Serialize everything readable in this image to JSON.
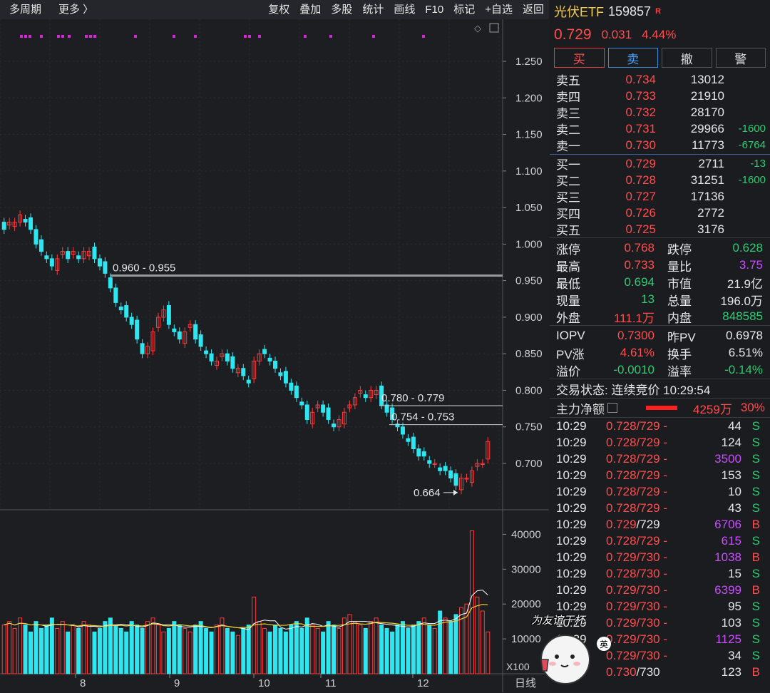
{
  "toolbar": {
    "period": "多周期",
    "more": "更多 〉",
    "buttons": [
      "复权",
      "叠加",
      "多股",
      "统计",
      "画线",
      "F10",
      "标记",
      "+自选",
      "返回"
    ]
  },
  "chart": {
    "price_axis": [
      "1.250",
      "1.200",
      "1.150",
      "1.100",
      "1.050",
      "1.000",
      "0.950",
      "0.900",
      "0.850",
      "0.800",
      "0.750",
      "0.700"
    ],
    "volume_axis": [
      "40000",
      "30000",
      "20000",
      "10000"
    ],
    "volume_unit": "X100",
    "x_labels": [
      "8",
      "9",
      "10",
      "11",
      "12"
    ],
    "period_label": "日线",
    "levels": [
      {
        "label": "0.960 - 0.955",
        "value": 0.957
      },
      {
        "label": "0.780 - 0.779",
        "value": 0.779
      },
      {
        "label": "0.754 - 0.753",
        "value": 0.753
      }
    ],
    "low_marker": "0.664"
  },
  "chart_data": {
    "type": "candlestick",
    "y_range": [
      0.66,
      1.27
    ],
    "levels": [
      0.957,
      0.779,
      0.753
    ],
    "low": 0.664,
    "close": [
      1.02,
      1.03,
      1.03,
      1.04,
      1.03,
      1.02,
      1.0,
      0.99,
      0.98,
      0.97,
      0.98,
      0.99,
      0.98,
      0.99,
      0.98,
      0.99,
      0.99,
      0.98,
      0.97,
      0.96,
      0.94,
      0.92,
      0.91,
      0.9,
      0.89,
      0.87,
      0.85,
      0.86,
      0.88,
      0.9,
      0.91,
      0.89,
      0.88,
      0.87,
      0.88,
      0.89,
      0.87,
      0.86,
      0.85,
      0.84,
      0.84,
      0.85,
      0.84,
      0.83,
      0.83,
      0.82,
      0.81,
      0.84,
      0.85,
      0.85,
      0.84,
      0.83,
      0.82,
      0.81,
      0.8,
      0.79,
      0.78,
      0.76,
      0.77,
      0.78,
      0.77,
      0.76,
      0.75,
      0.76,
      0.77,
      0.78,
      0.79,
      0.8,
      0.79,
      0.8,
      0.8,
      0.78,
      0.77,
      0.76,
      0.75,
      0.74,
      0.73,
      0.72,
      0.71,
      0.71,
      0.7,
      0.7,
      0.69,
      0.69,
      0.68,
      0.67,
      0.68,
      0.68,
      0.69,
      0.7,
      0.7,
      0.73
    ],
    "volume": [
      14,
      15,
      13,
      16,
      14,
      12,
      15,
      13,
      14,
      16,
      13,
      15,
      12,
      14,
      13,
      15,
      14,
      12,
      13,
      15,
      16,
      14,
      13,
      12,
      15,
      14,
      13,
      15,
      16,
      14,
      12,
      13,
      15,
      14,
      13,
      12,
      14,
      15,
      13,
      12,
      14,
      16,
      13,
      12,
      11,
      13,
      14,
      22,
      15,
      13,
      12,
      14,
      13,
      12,
      14,
      15,
      13,
      16,
      14,
      13,
      12,
      15,
      14,
      13,
      16,
      17,
      15,
      14,
      13,
      15,
      16,
      14,
      13,
      12,
      14,
      15,
      13,
      14,
      15,
      16,
      14,
      13,
      18,
      16,
      15,
      17,
      19,
      20,
      41,
      22,
      18,
      12
    ]
  },
  "quote": {
    "name": "光伏ETF",
    "code": "159857",
    "badge": "R",
    "price": "0.729",
    "change": "0.031",
    "change_pct": "4.44%",
    "actions": [
      "买",
      "卖",
      "撤",
      "警"
    ],
    "asks": [
      {
        "label": "卖五",
        "price": "0.734",
        "vol": "13012",
        "chg": ""
      },
      {
        "label": "卖四",
        "price": "0.733",
        "vol": "21910",
        "chg": ""
      },
      {
        "label": "卖三",
        "price": "0.732",
        "vol": "28170",
        "chg": ""
      },
      {
        "label": "卖二",
        "price": "0.731",
        "vol": "29966",
        "chg": "-1600"
      },
      {
        "label": "卖一",
        "price": "0.730",
        "vol": "11773",
        "chg": "-6764"
      }
    ],
    "bids": [
      {
        "label": "买一",
        "price": "0.729",
        "vol": "2711",
        "chg": "-13"
      },
      {
        "label": "买二",
        "price": "0.728",
        "vol": "31251",
        "chg": "-1600"
      },
      {
        "label": "买三",
        "price": "0.727",
        "vol": "17136",
        "chg": ""
      },
      {
        "label": "买四",
        "price": "0.726",
        "vol": "2772",
        "chg": ""
      },
      {
        "label": "买五",
        "price": "0.725",
        "vol": "3176",
        "chg": ""
      }
    ],
    "stats1": [
      {
        "k": "涨停",
        "v": "0.768",
        "vc": "red",
        "k2": "跌停",
        "v2": "0.628",
        "v2c": "green"
      },
      {
        "k": "最高",
        "v": "0.733",
        "vc": "red",
        "k2": "量比",
        "v2": "3.75",
        "v2c": "purple"
      },
      {
        "k": "最低",
        "v": "0.694",
        "vc": "green",
        "k2": "市值",
        "v2": "21.9亿",
        "v2c": "white"
      },
      {
        "k": "现量",
        "v": "13",
        "vc": "green",
        "k2": "总量",
        "v2": "196.0万",
        "v2c": "white"
      },
      {
        "k": "外盘",
        "v": "111.1万",
        "vc": "red",
        "k2": "内盘",
        "v2": "848585",
        "v2c": "green"
      }
    ],
    "stats2": [
      {
        "k": "IOPV",
        "v": "0.7300",
        "vc": "red",
        "k2": "昨PV",
        "v2": "0.6978",
        "v2c": "white"
      },
      {
        "k": "PV涨",
        "v": "4.61%",
        "vc": "red",
        "k2": "换手",
        "v2": "6.51%",
        "v2c": "white"
      },
      {
        "k": "溢价",
        "v": "-0.0010",
        "vc": "green",
        "k2": "溢率",
        "v2": "-0.14%",
        "v2c": "green"
      }
    ],
    "status": "交易状态: 连续竞价 10:29:54",
    "main_flow": {
      "label": "主力净额",
      "amount": "4259万",
      "pct": "30%"
    },
    "ticks": [
      {
        "t": "10:29",
        "p1": "0.728",
        "p2": "/729 -",
        "v": "44",
        "vc": "white",
        "d": "S"
      },
      {
        "t": "10:29",
        "p1": "0.728",
        "p2": "/729 -",
        "v": "124",
        "vc": "white",
        "d": "S"
      },
      {
        "t": "10:29",
        "p1": "0.728",
        "p2": "/729 -",
        "v": "3500",
        "vc": "purple",
        "d": "S"
      },
      {
        "t": "10:29",
        "p1": "0.728",
        "p2": "/729 -",
        "v": "153",
        "vc": "white",
        "d": "S"
      },
      {
        "t": "10:29",
        "p1": "0.728",
        "p2": "/729 -",
        "v": "10",
        "vc": "white",
        "d": "S"
      },
      {
        "t": "10:29",
        "p1": "0.728",
        "p2": "/729 -",
        "v": "43",
        "vc": "white",
        "d": "S"
      },
      {
        "t": "10:29",
        "p1": "0.729",
        "p2": "/729",
        "v": "6706",
        "vc": "purple",
        "d": "B"
      },
      {
        "t": "10:29",
        "p1": "0.728",
        "p2": "/729 -",
        "v": "615",
        "vc": "purple",
        "d": "S"
      },
      {
        "t": "10:29",
        "p1": "0.729",
        "p2": "/730 -",
        "v": "1038",
        "vc": "purple",
        "d": "B"
      },
      {
        "t": "10:29",
        "p1": "0.728",
        "p2": "/730 -",
        "v": "15",
        "vc": "white",
        "d": "S"
      },
      {
        "t": "10:29",
        "p1": "0.729",
        "p2": "/730 -",
        "v": "6399",
        "vc": "purple",
        "d": "B"
      },
      {
        "t": "10:29",
        "p1": "0.729",
        "p2": "/730 -",
        "v": "95",
        "vc": "white",
        "d": "S"
      },
      {
        "t": "10:29",
        "p1": "0.729",
        "p2": "/730 -",
        "v": "103",
        "vc": "white",
        "d": "S"
      },
      {
        "t": "10:29",
        "p1": "0.729",
        "p2": "/730 -",
        "v": "1125",
        "vc": "purple",
        "d": "S"
      },
      {
        "t": "10:29",
        "p1": "0.729",
        "p2": "/730 -",
        "v": "34",
        "vc": "white",
        "d": "S"
      },
      {
        "t": "10:29",
        "p1": "0.730",
        "p2": "/730",
        "v": "123",
        "vc": "white",
        "d": "B"
      }
    ]
  },
  "sticker": {
    "text": "为友谊干杯",
    "badge": "英"
  }
}
